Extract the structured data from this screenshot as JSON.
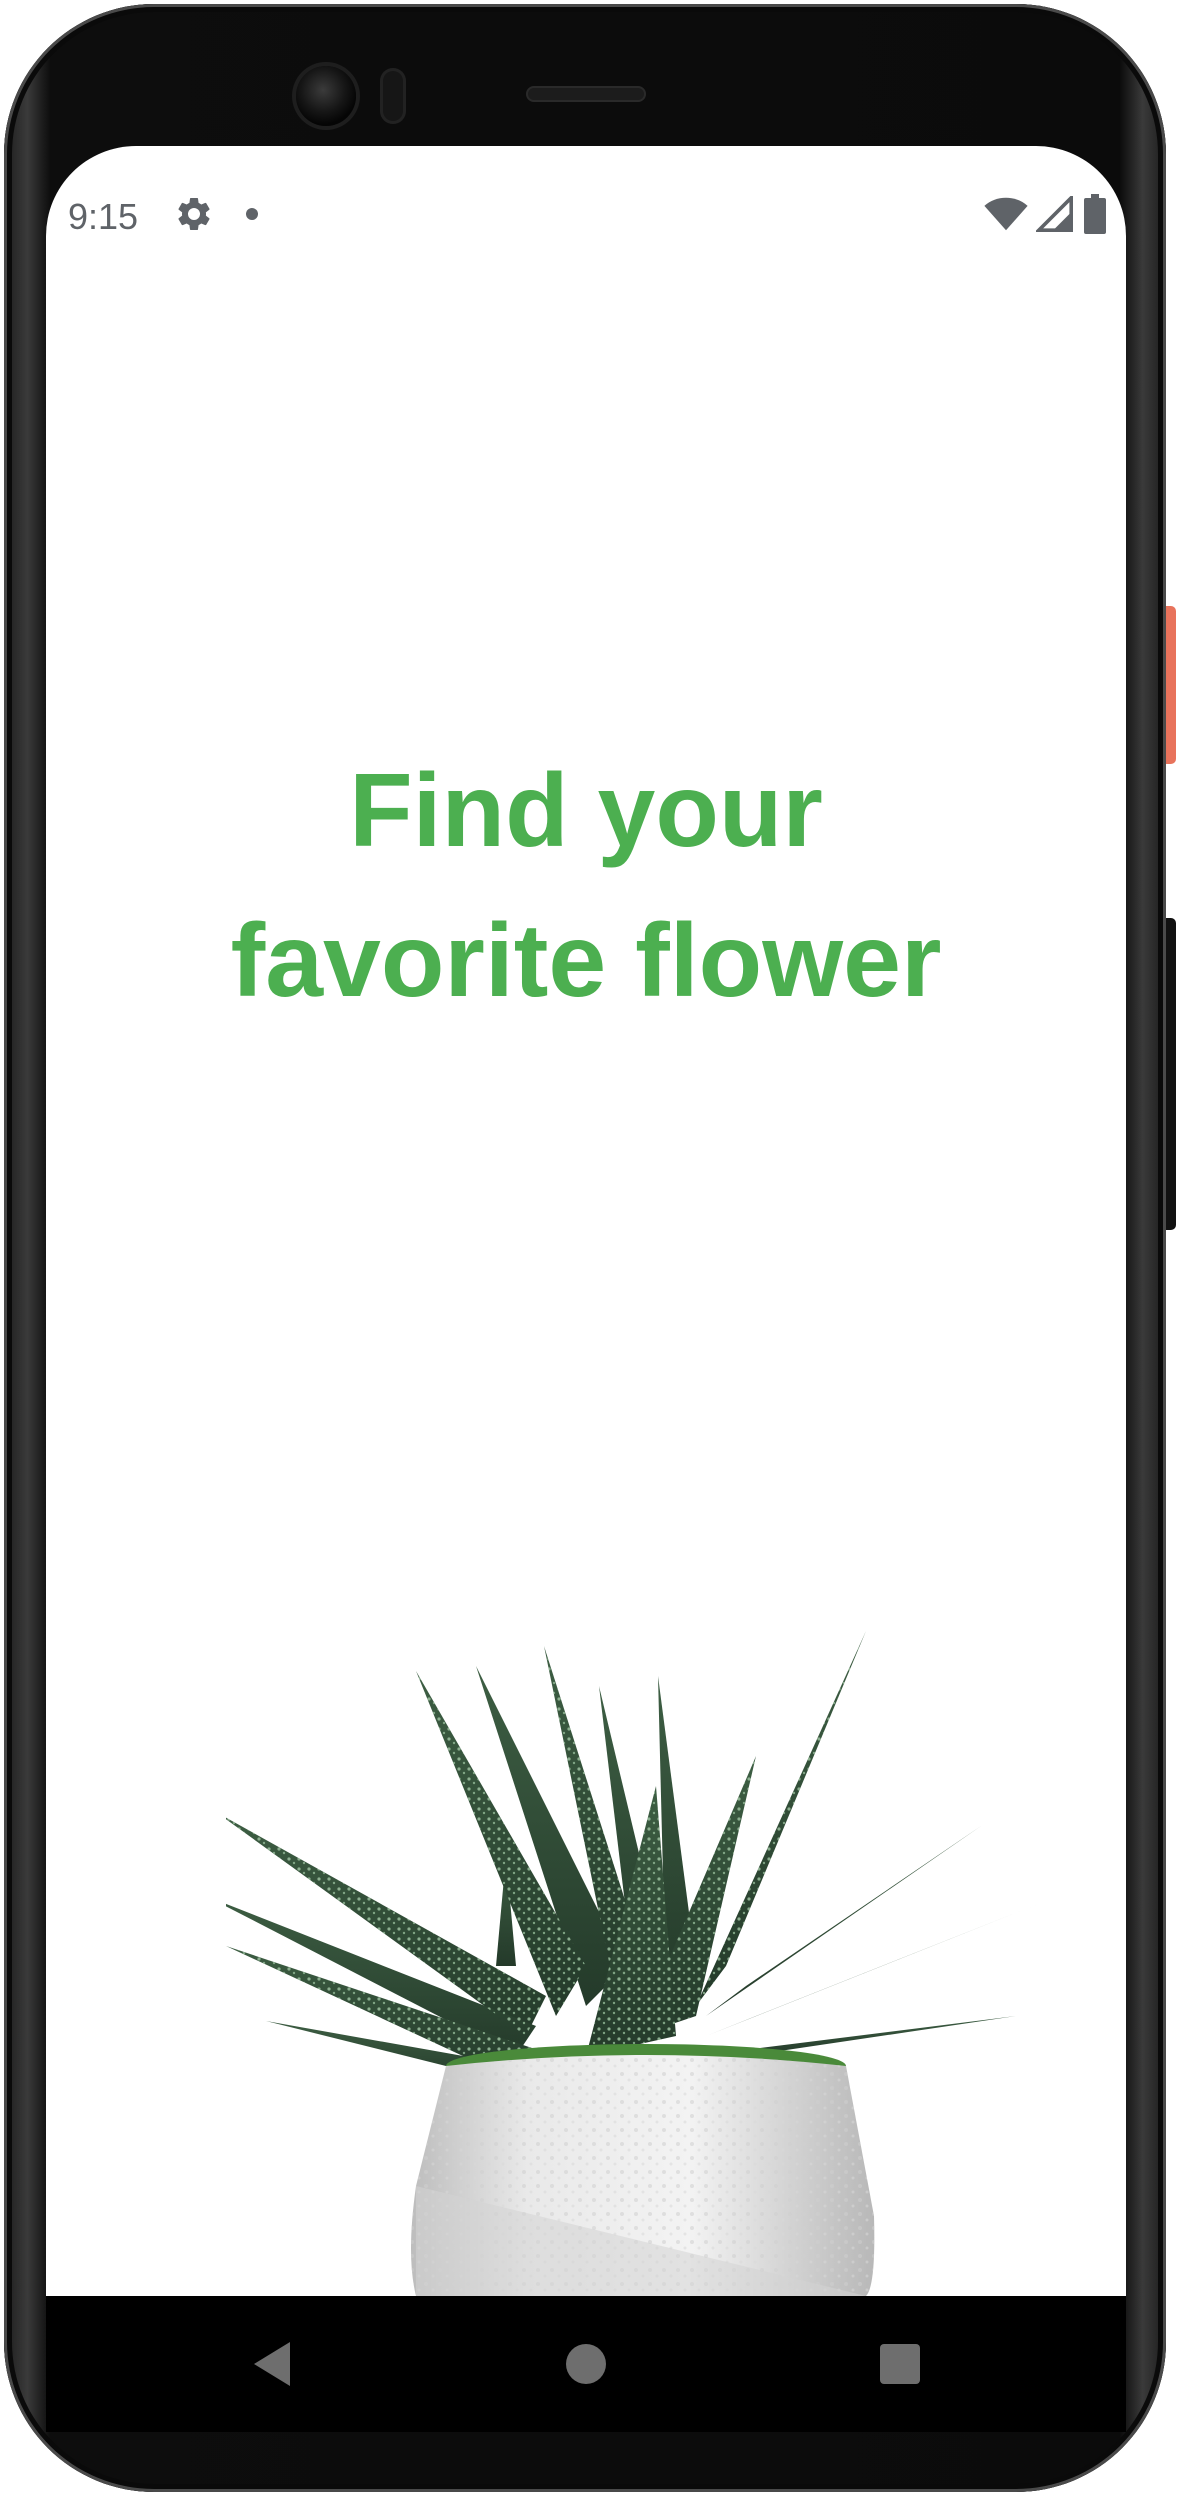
{
  "status_bar": {
    "time": "9:15",
    "icons": [
      "gear-icon",
      "notification-dot-icon",
      "wifi-icon",
      "cellular-signal-icon",
      "battery-icon"
    ]
  },
  "headline": {
    "line1": "Find your",
    "line2": "favorite flower"
  },
  "hero_image": "potted-succulent-plant",
  "nav_bar": {
    "buttons": [
      "back-icon",
      "home-icon",
      "recents-icon"
    ]
  },
  "colors": {
    "accent": "#4caf50",
    "status_text": "#5f6368",
    "nav_background": "#000000"
  }
}
